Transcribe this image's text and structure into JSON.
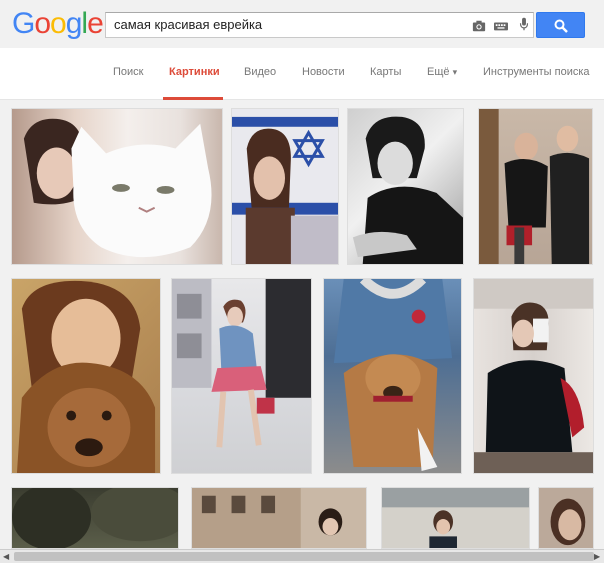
{
  "logo": {
    "letters": [
      "G",
      "o",
      "o",
      "g",
      "l",
      "e"
    ],
    "colors": [
      "#4285f4",
      "#ea4335",
      "#fbbc05",
      "#4285f4",
      "#34a853",
      "#ea4335"
    ]
  },
  "search": {
    "query": "самая красивая еврейка"
  },
  "nav": {
    "items": [
      {
        "label": "Поиск",
        "active": false
      },
      {
        "label": "Картинки",
        "active": true
      },
      {
        "label": "Видео",
        "active": false
      },
      {
        "label": "Новости",
        "active": false
      },
      {
        "label": "Карты",
        "active": false
      },
      {
        "label": "Ещё",
        "active": false
      }
    ],
    "more_arrow": "▾",
    "tools": "Инструменты поиска"
  },
  "colors": {
    "accent": "#dd4b39",
    "search_button": "#4285f4"
  },
  "results": [
    "result-1-girl-with-white-cat",
    "result-2-girl-with-israeli-flag",
    "result-3-girl-black-and-white",
    "result-4-two-people",
    "result-5-girl-with-dog",
    "result-6-girl-on-street",
    "result-7-dog-on-leash",
    "result-8-mirror-selfie",
    "result-9",
    "result-10",
    "result-11",
    "result-12"
  ]
}
